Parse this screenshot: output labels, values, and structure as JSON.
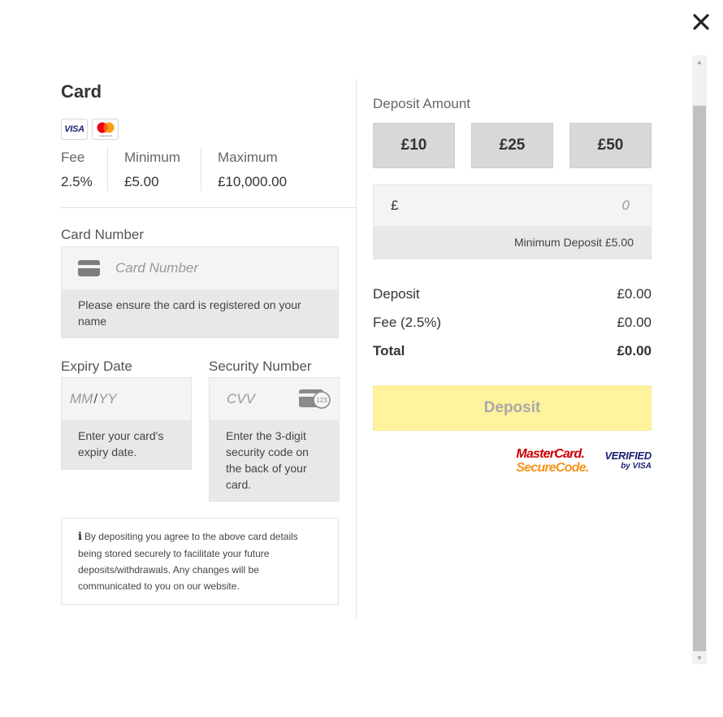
{
  "method": {
    "title": "Card",
    "logos": [
      "VISA",
      "mastercard"
    ],
    "fee": {
      "label": "Fee",
      "value": "2.5%"
    },
    "minimum": {
      "label": "Minimum",
      "value": "£5.00"
    },
    "maximum": {
      "label": "Maximum",
      "value": "£10,000.00"
    }
  },
  "card_number": {
    "label": "Card Number",
    "placeholder": "Card Number",
    "hint": "Please ensure the card is registered on your name",
    "icon": "credit-card-icon"
  },
  "expiry": {
    "label": "Expiry Date",
    "placeholder_month": "MM",
    "separator": "/",
    "placeholder_year": "YY",
    "hint": "Enter your card's expiry date."
  },
  "security": {
    "label": "Security Number",
    "placeholder": "CVV",
    "icon": "cvv-card-icon",
    "icon_text": "123",
    "hint": "Enter the 3-digit security code on the back of your card."
  },
  "notice": {
    "icon": "info-icon",
    "text": "By depositing you agree to the above card details being stored securely to facilitate your future deposits/withdrawals. Any changes will be communicated to you on our website."
  },
  "deposit_amount": {
    "label": "Deposit Amount",
    "quick_amounts": [
      "£10",
      "£25",
      "£50"
    ],
    "currency_symbol": "£",
    "value": "0",
    "min_hint": "Minimum Deposit £5.00"
  },
  "summary": {
    "deposit": {
      "label": "Deposit",
      "value": "£0.00"
    },
    "fee": {
      "label": "Fee (2.5%)",
      "value": "£0.00"
    },
    "total": {
      "label": "Total",
      "value": "£0.00"
    }
  },
  "deposit_button": "Deposit",
  "security_logos": {
    "mastercard_line1": "MasterCard.",
    "mastercard_line2": "SecureCode.",
    "visa_line1": "VERIFIED",
    "visa_line2": "by VISA"
  },
  "colors": {
    "deposit_button_bg": "#fff39e",
    "amount_button_bg": "#d8d8d8",
    "mastercard_red": "#cc0000",
    "mastercard_orange": "#f7941d",
    "visa_blue": "#1a1f71"
  }
}
